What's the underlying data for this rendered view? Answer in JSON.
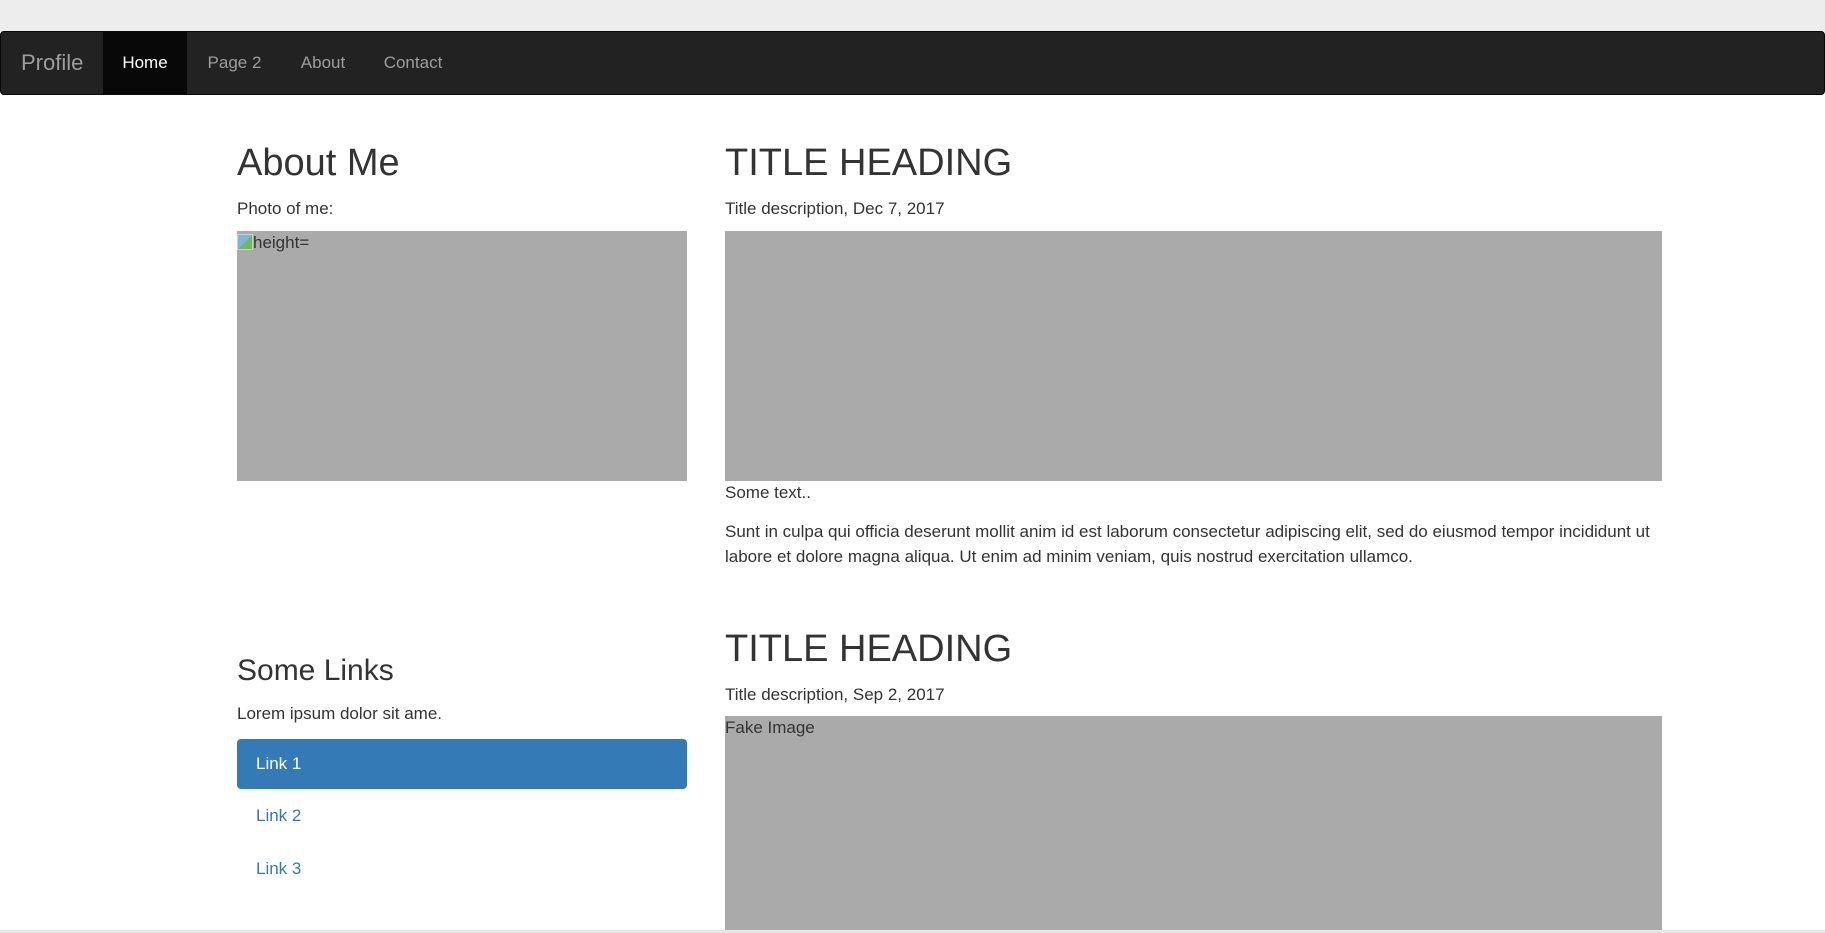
{
  "navbar": {
    "brand": "Profile",
    "items": [
      {
        "label": "Home",
        "active": true
      },
      {
        "label": "Page 2",
        "active": false
      },
      {
        "label": "About",
        "active": false
      },
      {
        "label": "Contact",
        "active": false
      }
    ]
  },
  "sidebar": {
    "about_title": "About Me",
    "photo_label": "Photo of me:",
    "photo_alt": "height=",
    "links_title": "Some Links",
    "links_intro": "Lorem ipsum dolor sit ame.",
    "links": [
      {
        "label": "Link 1",
        "active": true
      },
      {
        "label": "Link 2",
        "active": false
      },
      {
        "label": "Link 3",
        "active": false
      }
    ]
  },
  "posts": [
    {
      "title": "TITLE HEADING",
      "description": "Title description, Dec 7, 2017",
      "image_text": "",
      "short_text": "Some text..",
      "body": "Sunt in culpa qui officia deserunt mollit anim id est laborum consectetur adipiscing elit, sed do eiusmod tempor incididunt ut labore et dolore magna aliqua. Ut enim ad minim veniam, quis nostrud exercitation ullamco."
    },
    {
      "title": "TITLE HEADING",
      "description": "Title description, Sep 2, 2017",
      "image_text": "Fake Image"
    }
  ],
  "colors": {
    "navbar_bg": "#222222",
    "nav_active_bg": "#080808",
    "link_accent": "#337ab7",
    "placeholder_grey": "#aaaaaa"
  }
}
